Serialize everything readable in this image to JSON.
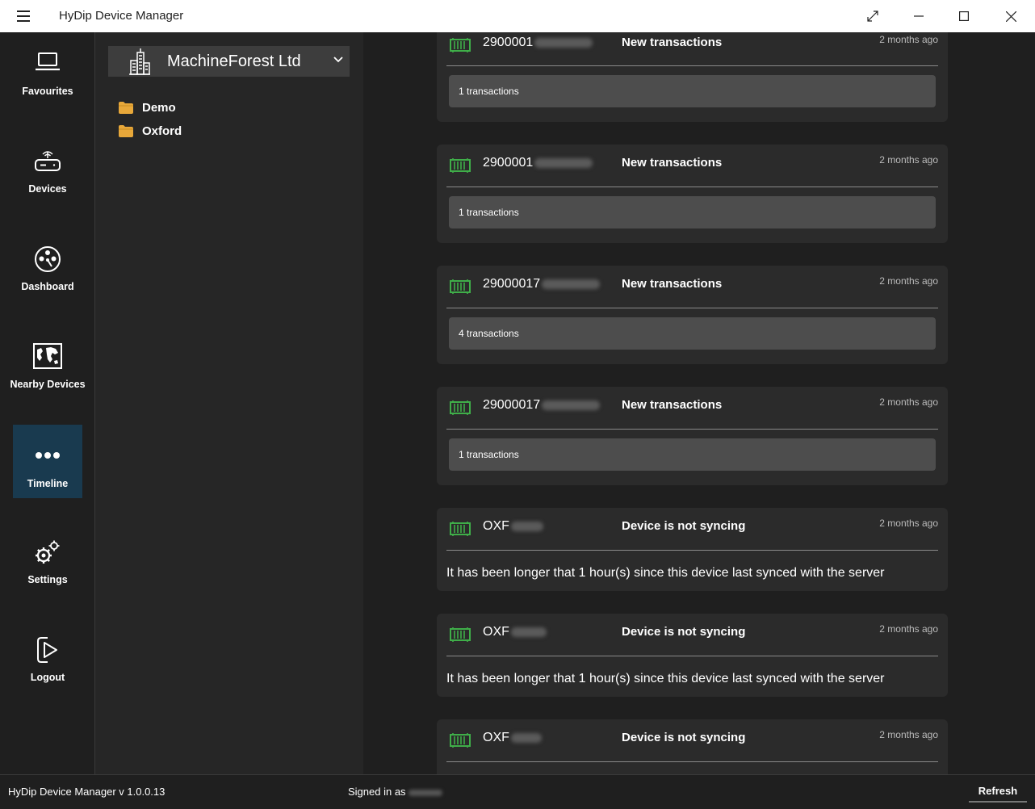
{
  "window": {
    "title": "HyDip Device Manager"
  },
  "nav": {
    "items": [
      {
        "label": "Favourites",
        "icon": "laptop-icon"
      },
      {
        "label": "Devices",
        "icon": "router-icon"
      },
      {
        "label": "Dashboard",
        "icon": "dashboard-icon"
      },
      {
        "label": "Nearby Devices",
        "icon": "map-icon"
      },
      {
        "label": "Timeline",
        "icon": "dots-icon",
        "active": true
      },
      {
        "label": "Settings",
        "icon": "gear-icon"
      },
      {
        "label": "Logout",
        "icon": "logout-icon"
      }
    ]
  },
  "sidebar": {
    "organisation": "MachineForest Ltd",
    "folders": [
      "Demo",
      "Oxford"
    ]
  },
  "timeline": {
    "cards": [
      {
        "serial": "2900001",
        "event": "New transactions",
        "time": "2 months ago",
        "detail": "1 transactions",
        "kind": "transactions"
      },
      {
        "serial": "2900001",
        "event": "New transactions",
        "time": "2 months ago",
        "detail": "1 transactions",
        "kind": "transactions"
      },
      {
        "serial": "29000017",
        "event": "New transactions",
        "time": "2 months ago",
        "detail": "4 transactions",
        "kind": "transactions"
      },
      {
        "serial": "29000017",
        "event": "New transactions",
        "time": "2 months ago",
        "detail": "1 transactions",
        "kind": "transactions"
      },
      {
        "serial": "OXF",
        "event": "Device is not syncing",
        "time": "2 months ago",
        "detail": "It has been longer that 1 hour(s) since this device last synced with the server",
        "kind": "message"
      },
      {
        "serial": "OXF",
        "event": "Device is not syncing",
        "time": "2 months ago",
        "detail": "It has been longer that 1 hour(s) since this device last synced with the server",
        "kind": "message"
      },
      {
        "serial": "OXF",
        "event": "Device is not syncing",
        "time": "2 months ago",
        "detail": "",
        "kind": "message"
      }
    ]
  },
  "status": {
    "version": "HyDip Device Manager v 1.0.0.13",
    "signed_in": "Signed in as",
    "refresh": "Refresh"
  },
  "colors": {
    "accent_active": "#193a4f",
    "device_icon": "#3fae49",
    "card_bg": "#2b2b2b"
  }
}
